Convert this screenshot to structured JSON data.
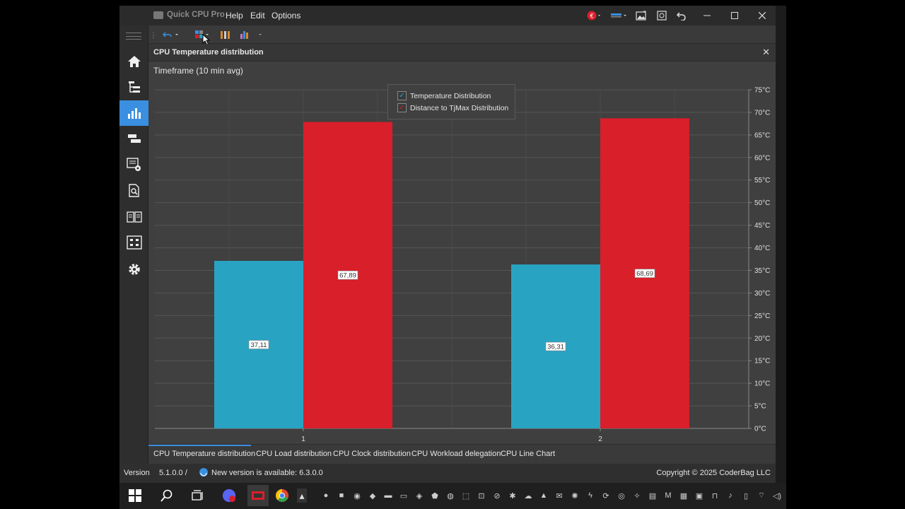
{
  "app": {
    "title": "Quick CPU Pro",
    "menu": [
      "Help",
      "Edit",
      "Options"
    ]
  },
  "panel": {
    "title": "CPU Temperature distribution",
    "timeframe": "Timeframe (10 min avg)"
  },
  "legend": {
    "series1": "Temperature Distribution",
    "series2": "Distance to TjMax Distribution"
  },
  "chart_data": {
    "type": "bar",
    "categories": [
      "1",
      "2"
    ],
    "series": [
      {
        "name": "Temperature Distribution",
        "values": [
          37.11,
          36.31
        ],
        "labels": [
          "37,11",
          "36,31"
        ],
        "color": "#29a3c2"
      },
      {
        "name": "Distance to TjMax Distribution",
        "values": [
          67.89,
          68.69
        ],
        "labels": [
          "67,89",
          "68,69"
        ],
        "color": "#d81f2a"
      }
    ],
    "ylim": [
      0,
      75
    ],
    "yticks": [
      0,
      5,
      10,
      15,
      20,
      25,
      30,
      35,
      40,
      45,
      50,
      55,
      60,
      65,
      70,
      75
    ],
    "ytick_labels": [
      "0°C",
      "5°C",
      "10°C",
      "15°C",
      "20°C",
      "25°C",
      "30°C",
      "35°C",
      "40°C",
      "45°C",
      "50°C",
      "55°C",
      "60°C",
      "65°C",
      "70°C",
      "75°C"
    ],
    "y_axis_position": "right",
    "grid": true,
    "legend_position": "top-center"
  },
  "tabs": [
    "CPU Temperature distribution",
    "CPU Load distribution",
    "CPU Clock distribution",
    "CPU Workload delegation",
    "CPU Line Chart"
  ],
  "status": {
    "version_label": "Version",
    "version_value": "5.1.0.0  /",
    "update_text": "New version is available: 6.3.0.0",
    "copyright": "Copyright © 2025 CoderBag LLC"
  },
  "sidebar_icons": [
    "home-icon",
    "tree-icon",
    "bar-chart-icon",
    "layout-icon",
    "settings-list-icon",
    "document-search-icon",
    "book-icon",
    "grid-icon",
    "gear-icon"
  ],
  "colors": {
    "accent": "#3a8fe0",
    "series_blue": "#29a3c2",
    "series_red": "#d81f2a"
  }
}
